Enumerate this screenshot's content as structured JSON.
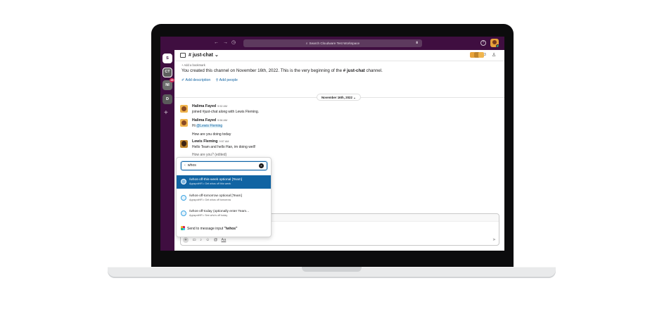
{
  "topbar": {
    "back": "←",
    "forward": "→",
    "history": "◷",
    "search_placeholder": "Search Cloudware Test Workspace",
    "filter": "⩩",
    "help": "?"
  },
  "rail": {
    "workspaces": [
      {
        "label": "S"
      },
      {
        "label": "CT"
      },
      {
        "label": "NI",
        "badge": "25"
      },
      {
        "label": "D"
      }
    ],
    "add": "+"
  },
  "channel": {
    "name": "# just-chat ⌄",
    "member_count": "3",
    "add_bookmark": "+ Add a bookmark",
    "intro_prefix": "You created this channel on November 16th, 2022. This is the very beginning of the ",
    "intro_channel": "# just-chat",
    "intro_suffix": " channel.",
    "add_description": "✐ Add description",
    "add_people": "⚲ Add people",
    "date_label": "November 16th, 2022 ⌄"
  },
  "messages": [
    {
      "name": "Halima Fayed",
      "time": "9:52 AM",
      "text": "joined #just-chat along with Lewis Fleming."
    },
    {
      "name": "Halima Fayed",
      "time": "9:56 AM",
      "mention": "@Lewis Fleming",
      "prefix": "Hi "
    },
    {
      "text": "How are you doing today"
    },
    {
      "name": "Lewis Fleming",
      "time": "9:57 AM",
      "text": "Hello Team and hello Han, im doing well!"
    },
    {
      "text": "How are you? (edited)"
    }
  ],
  "dropdown": {
    "query": "whos",
    "back": "‹",
    "clear": "×",
    "items": [
      {
        "command": "/whos-off-this-week optional [Team]",
        "source": "AppspotHR • Get whos off this week",
        "selected": true
      },
      {
        "command": "/whos-off-tomorrow optional [Team]",
        "source": "AppspotHR • Get whos off tomorrow",
        "selected": false
      },
      {
        "command": "/whos-off-today (optionally enter Team...",
        "source": "AppspotHR • See who's off today",
        "selected": false
      }
    ],
    "send_prefix": "Send to message input ",
    "send_value": "\"/whos\""
  },
  "composer": {
    "plus": "+",
    "video": "▭",
    "mic": "♪",
    "emoji": "☺",
    "mention": "@",
    "format": "Aa",
    "send": "➤"
  },
  "colors": {
    "aubergine": "#3f0e40",
    "selection_blue": "#1164a3",
    "link_blue": "#1264a3"
  }
}
